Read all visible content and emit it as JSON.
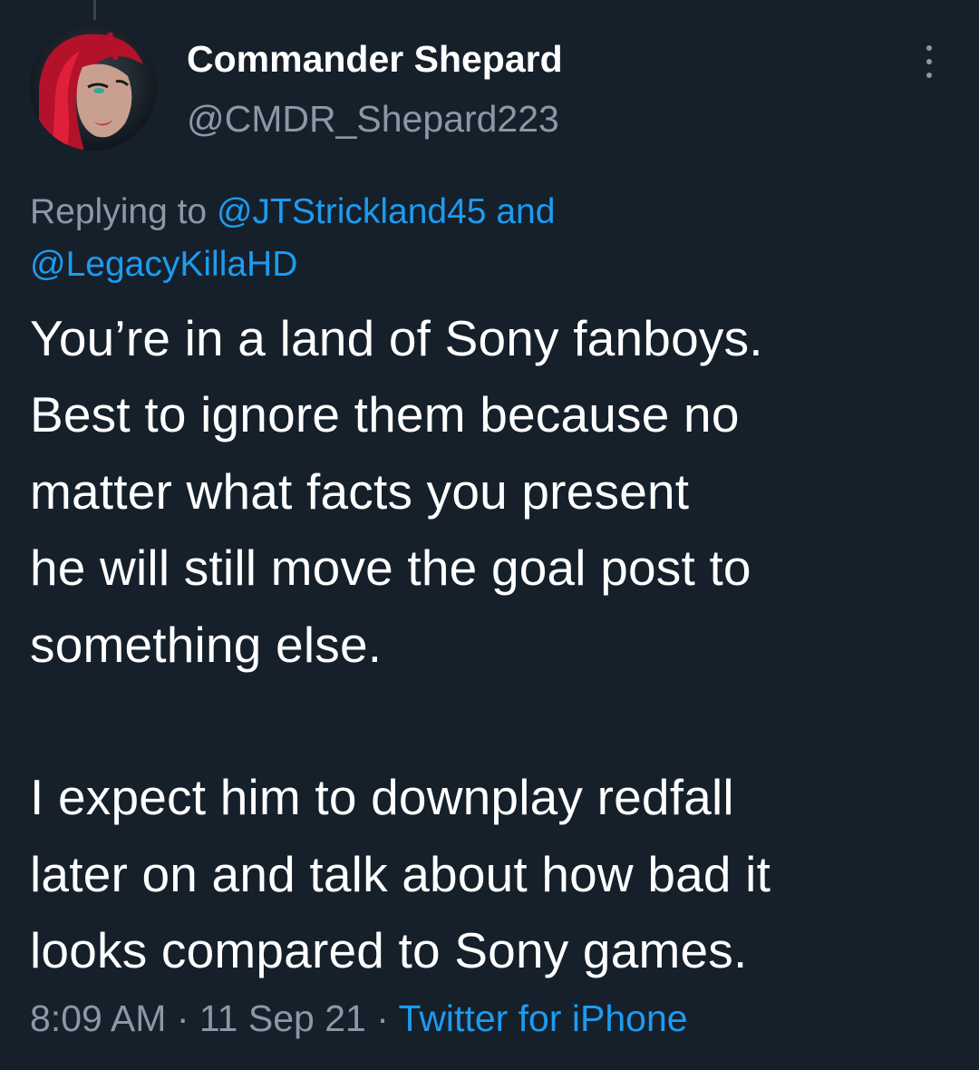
{
  "author": {
    "display_name": "Commander Shepard",
    "handle": "@CMDR_Shepard223",
    "avatar_icon": "avatar-portrait-red-hair"
  },
  "reply": {
    "prefix": "Replying to",
    "mentions": [
      "@JTStrickland45",
      "@LegacyKillaHD"
    ],
    "conjunction": "and"
  },
  "tweet": {
    "paragraph_1_lines": [
      "You’re in a land of Sony fanboys.",
      "Best to ignore them because no",
      "matter what facts you present",
      "he will still move the goal post to",
      "something else."
    ],
    "paragraph_2_lines": [
      "I expect him to downplay redfall",
      "later on and talk about how bad it",
      "looks compared to Sony games."
    ]
  },
  "meta": {
    "time": "8:09 AM",
    "date": "11 Sep 21",
    "separator": "·",
    "source": "Twitter for iPhone"
  },
  "colors": {
    "background": "#15202b",
    "primary_text": "#ffffff",
    "secondary_text": "#8b98a5",
    "link": "#1d9bf0"
  }
}
